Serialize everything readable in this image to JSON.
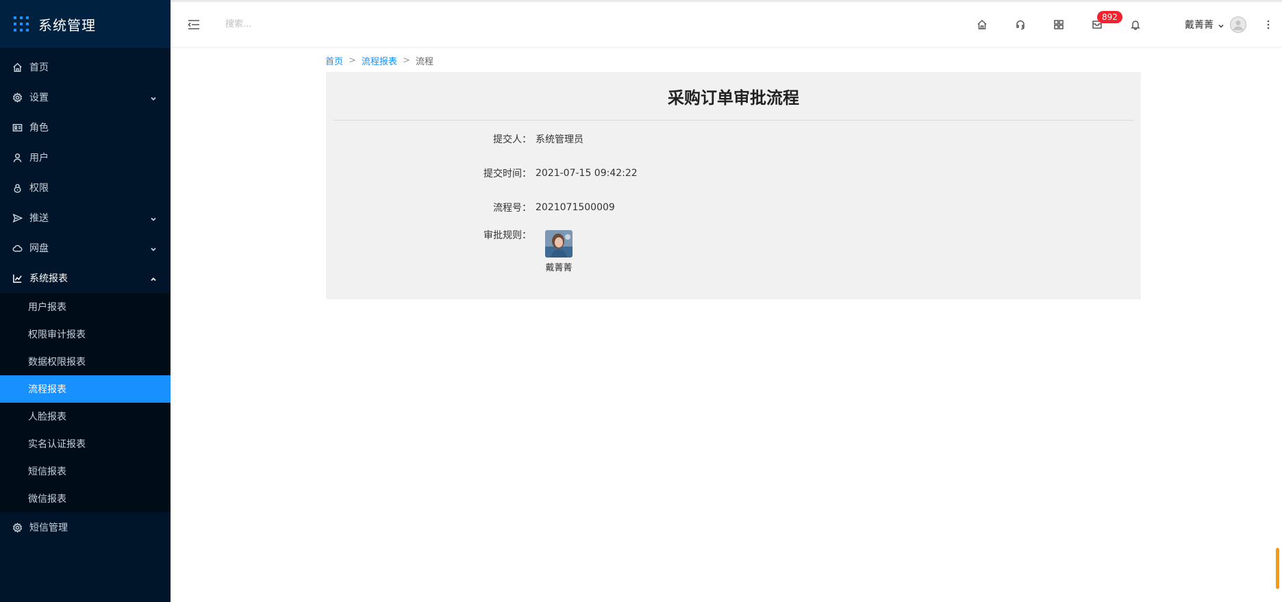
{
  "app": {
    "title": "系统管理"
  },
  "sidebar": {
    "items": [
      {
        "label": "首页",
        "icon": "home-icon"
      },
      {
        "label": "设置",
        "icon": "gear-icon",
        "has_children": true
      },
      {
        "label": "角色",
        "icon": "id-card-icon"
      },
      {
        "label": "用户",
        "icon": "user-icon"
      },
      {
        "label": "权限",
        "icon": "lock-icon"
      },
      {
        "label": "推送",
        "icon": "send-icon",
        "has_children": true
      },
      {
        "label": "网盘",
        "icon": "cloud-icon",
        "has_children": true
      },
      {
        "label": "系统报表",
        "icon": "chart-icon",
        "has_children": true,
        "open": true
      }
    ],
    "report_sub": [
      "用户报表",
      "权限审计报表",
      "数据权限报表",
      "流程报表",
      "人脸报表",
      "实名认证报表",
      "短信报表",
      "微信报表"
    ],
    "active_sub": "流程报表",
    "bottom_item": {
      "label": "短信管理",
      "icon": "gear-icon"
    }
  },
  "header": {
    "search_placeholder": "搜索...",
    "badge_count": "892",
    "user_name": "戴菁菁"
  },
  "breadcrumb": {
    "home": "首页",
    "parent": "流程报表",
    "current": "流程"
  },
  "detail": {
    "title": "采购订单审批流程",
    "submitter_label": "提交人：",
    "submitter": "系统管理员",
    "time_label": "提交时间：",
    "time": "2021-07-15 09:42:22",
    "flow_no_label": "流程号：",
    "flow_no": "2021071500009",
    "rule_label": "审批规则：",
    "approver_name": "戴菁菁"
  },
  "colors": {
    "sidebar_bg": "#001529",
    "active": "#1890ff",
    "badge": "#f5222d",
    "card_bg": "#f1f1f1"
  }
}
